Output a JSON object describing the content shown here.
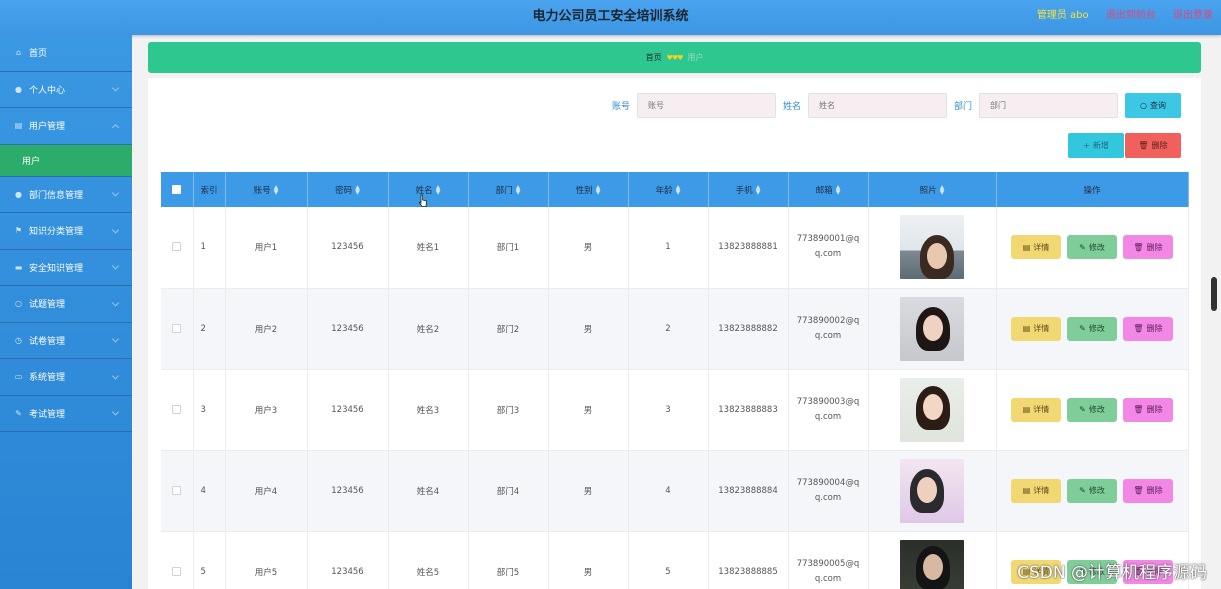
{
  "header": {
    "title": "电力公司员工安全培训系统",
    "admin_label": "管理员 abo",
    "back_link": "退出到前台",
    "logout_link": "退出登录"
  },
  "sidebar": {
    "items": [
      {
        "label": "首页",
        "icon": "home-icon"
      },
      {
        "label": "个人中心",
        "icon": "user-icon"
      },
      {
        "label": "用户管理",
        "icon": "document-icon",
        "expanded": true,
        "sub": "用户"
      },
      {
        "label": "部门信息管理",
        "icon": "user-icon"
      },
      {
        "label": "知识分类管理",
        "icon": "flag-icon"
      },
      {
        "label": "安全知识管理",
        "icon": "card-icon"
      },
      {
        "label": "试题管理",
        "icon": "power-icon"
      },
      {
        "label": "试卷管理",
        "icon": "clock-icon"
      },
      {
        "label": "系统管理",
        "icon": "monitor-icon"
      },
      {
        "label": "考试管理",
        "icon": "pen-icon"
      }
    ]
  },
  "breadcrumb": {
    "home": "首页",
    "current": "用户"
  },
  "search": {
    "account_label": "账号",
    "account_placeholder": "账号",
    "name_label": "姓名",
    "name_placeholder": "姓名",
    "dept_label": "部门",
    "dept_placeholder": "部门",
    "query_button": "查询"
  },
  "actions": {
    "add": "新增",
    "delete": "删除"
  },
  "table": {
    "headers": [
      "索引",
      "账号",
      "密码",
      "姓名",
      "部门",
      "性别",
      "年龄",
      "手机",
      "邮箱",
      "照片",
      "操作"
    ],
    "rows": [
      {
        "idx": "1",
        "account": "用户1",
        "password": "123456",
        "name": "姓名1",
        "dept": "部门1",
        "gender": "男",
        "age": "1",
        "phone": "13823888881",
        "email": "773890001@qq.com"
      },
      {
        "idx": "2",
        "account": "用户2",
        "password": "123456",
        "name": "姓名2",
        "dept": "部门2",
        "gender": "男",
        "age": "2",
        "phone": "13823888882",
        "email": "773890002@qq.com"
      },
      {
        "idx": "3",
        "account": "用户3",
        "password": "123456",
        "name": "姓名3",
        "dept": "部门3",
        "gender": "男",
        "age": "3",
        "phone": "13823888883",
        "email": "773890003@qq.com"
      },
      {
        "idx": "4",
        "account": "用户4",
        "password": "123456",
        "name": "姓名4",
        "dept": "部门4",
        "gender": "男",
        "age": "4",
        "phone": "13823888884",
        "email": "773890004@qq.com"
      },
      {
        "idx": "5",
        "account": "用户5",
        "password": "123456",
        "name": "姓名5",
        "dept": "部门5",
        "gender": "男",
        "age": "5",
        "phone": "13823888885",
        "email": "773890005@qq.com"
      }
    ],
    "op_detail": "详情",
    "op_edit": "修改",
    "op_delete": "删除"
  },
  "watermark": "CSDN @计算机程序源码",
  "colors": {
    "header": "#3d96e3",
    "sidebar": "#2a84d4",
    "active": "#2bac6b",
    "breadcrumb": "#2fc790",
    "table_head": "#3c9ae7"
  }
}
